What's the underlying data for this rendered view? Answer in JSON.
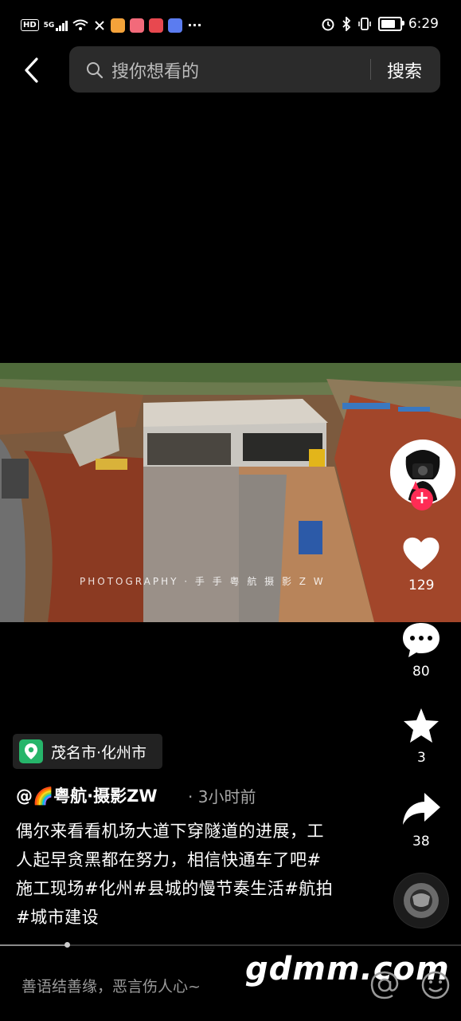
{
  "status_bar": {
    "left_label": "HD",
    "signal_label": "5G",
    "time": "6:29",
    "battery_level": 0.8
  },
  "search": {
    "placeholder": "搜你想看的",
    "button_label": "搜索"
  },
  "video": {
    "watermark": "PHOTOGRAPHY · 手 手 粤 航   摄 影 Z W"
  },
  "actions": {
    "likes": "129",
    "comments": "80",
    "favorites": "3",
    "shares": "38"
  },
  "location": "茂名市·化州市",
  "author": "@🌈粤航·摄影ZW",
  "time_ago": "· 3小时前",
  "caption": "偶尔来看看机场大道下穿隧道的进展，工人起早贪黑都在努力，相信快通车了吧#施工现场#化州#县城的慢节奏生活#航拍#城市建设",
  "comment_input_placeholder": "善语结善缘，恶言伤人心~",
  "site_watermark": "gdmm.com",
  "progress": 0.145,
  "colors": {
    "follow": "#fe2c55",
    "location_pin": "#26b56a",
    "background": "#000000"
  }
}
